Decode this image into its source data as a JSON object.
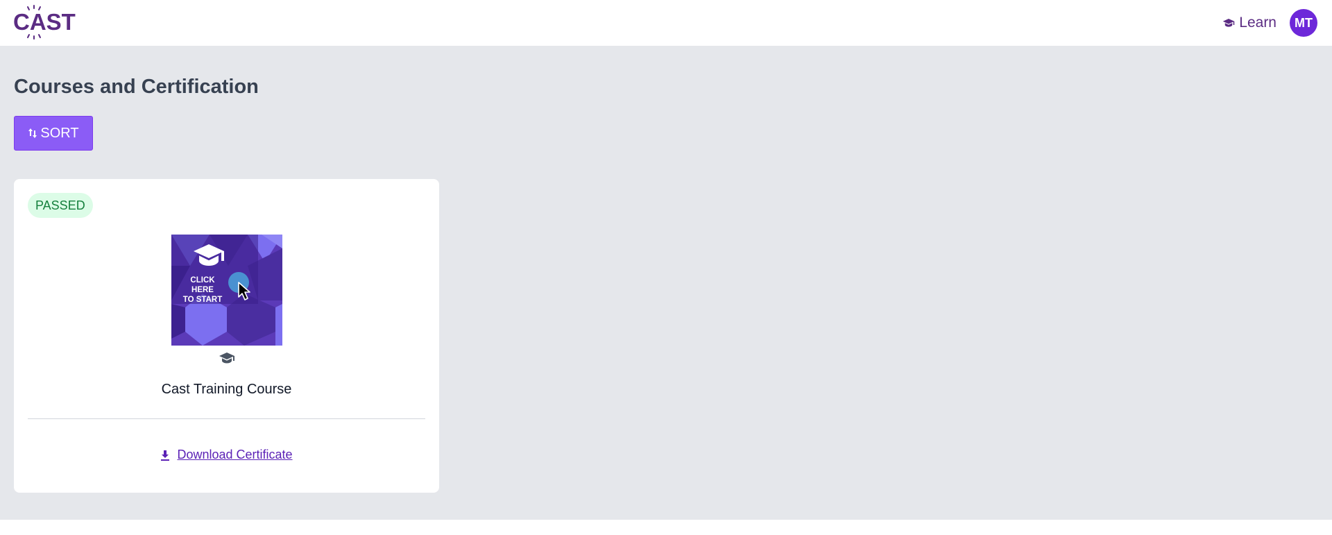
{
  "header": {
    "logo_text": "CAST",
    "nav": {
      "learn_label": "Learn",
      "learn_icon": "graduation-cap-icon"
    },
    "avatar_initials": "MT"
  },
  "page": {
    "title": "Courses and Certification",
    "sort_label": "SORT",
    "sort_icon": "sort-arrows-icon"
  },
  "courses": [
    {
      "status": "PASSED",
      "thumbnail_text": [
        "CLICK HERE",
        "TO START"
      ],
      "thumbnail_icons": [
        "graduation-cap-icon",
        "cursor-pointer-icon"
      ],
      "course_icon": "graduation-cap-icon",
      "title": "Cast Training Course",
      "action_label": "Download Certificate",
      "action_icon": "download-icon"
    }
  ],
  "colors": {
    "brand_purple": "#5b2c83",
    "accent_violet": "#8b5cf6",
    "avatar_bg": "#6d28d9",
    "badge_bg": "#dcfce7",
    "badge_text": "#15803d",
    "page_bg": "#e5e7eb"
  }
}
